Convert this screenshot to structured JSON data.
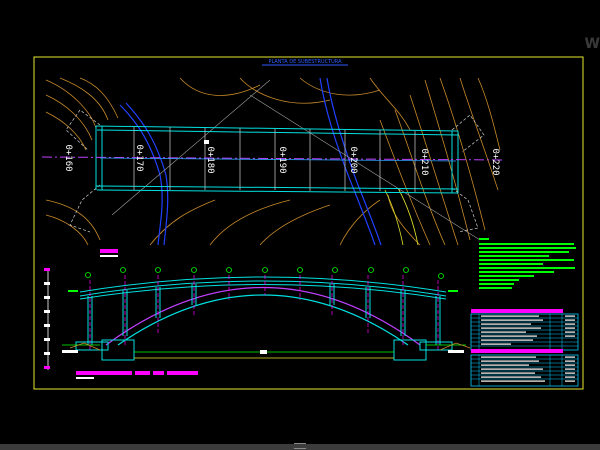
{
  "app": {
    "corner_text": "W"
  },
  "drawing": {
    "title": "PLANTA DE SUBESTRUCTURA",
    "stations": [
      "0+160",
      "0+170",
      "0+180",
      "0+190",
      "0+200",
      "0+210",
      "0+220"
    ],
    "colors": {
      "background": "#000000",
      "frame": "#e6e62e",
      "deck": "#00e0e0",
      "arch": "#c040ff",
      "contour": "#c88a2a",
      "river": "#2040ff",
      "note": "#00ff00",
      "magenta": "#ff00ff",
      "table": "#00c8ff"
    }
  }
}
